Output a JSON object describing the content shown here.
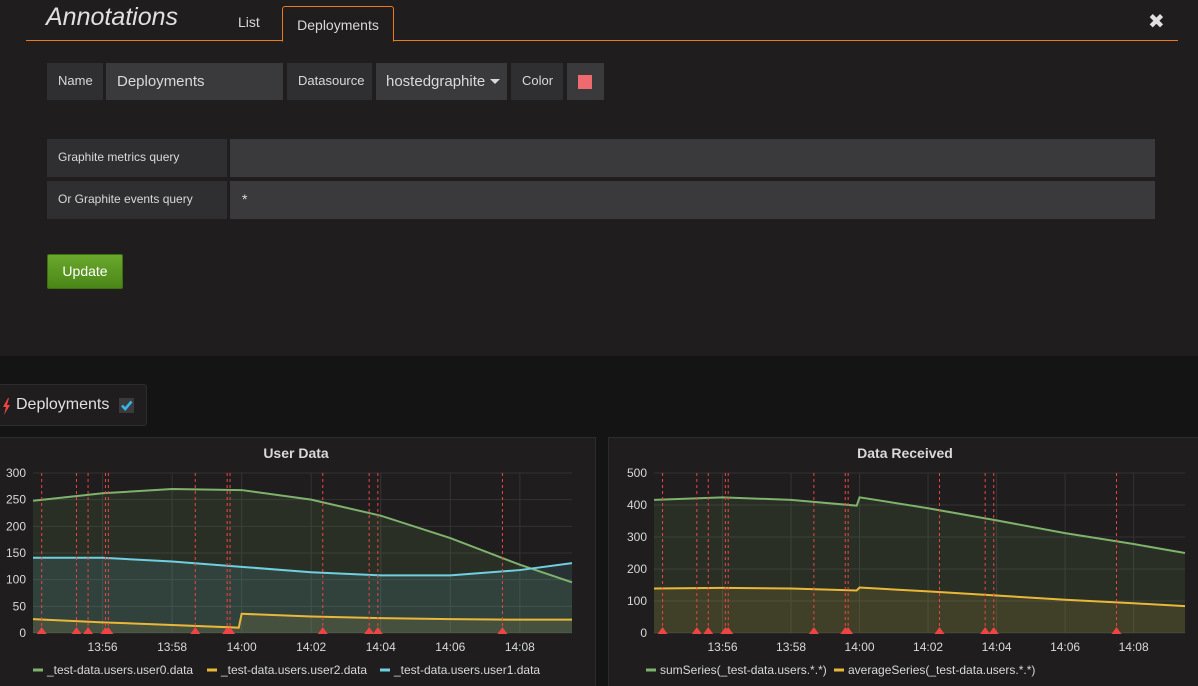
{
  "editor": {
    "title": "Annotations",
    "tabs": [
      {
        "label": "List"
      },
      {
        "label": "Deployments"
      }
    ],
    "close_glyph": "✖",
    "name_label": "Name",
    "name_value": "Deployments",
    "datasource_label": "Datasource",
    "datasource_value": "hostedgraphite",
    "color_label": "Color",
    "color_value": "#ee6a6f",
    "metrics_query_label": "Graphite metrics query",
    "metrics_query_value": "",
    "events_query_label": "Or Graphite events query",
    "events_query_value": "*",
    "update_label": "Update"
  },
  "annotation_toggle": {
    "icon": "bolt-icon",
    "name": "Deployments",
    "checked": true
  },
  "chart_data": [
    {
      "type": "line",
      "title": "User Data",
      "x_ticks": [
        "13:56",
        "13:58",
        "14:00",
        "14:02",
        "14:04",
        "14:06",
        "14:08"
      ],
      "ylim": [
        0,
        300
      ],
      "y_ticks": [
        0,
        50,
        100,
        150,
        200,
        250,
        300
      ],
      "grid": true,
      "legend_position": "bottom",
      "annotations": [
        "13:54:15",
        "13:55:15",
        "13:55:35",
        "13:56:05",
        "13:56:10",
        "13:58:40",
        "13:59:35",
        "13:59:40",
        "14:02:20",
        "14:03:40",
        "14:03:55",
        "14:07:30"
      ],
      "series": [
        {
          "name": "_test-data.users.user0.data",
          "color": "#7eb26d",
          "x": [
            "13:54",
            "13:56",
            "13:58",
            "14:00",
            "14:02",
            "14:04",
            "14:06",
            "14:08",
            "14:09:30"
          ],
          "values": [
            248,
            262,
            270,
            268,
            250,
            220,
            178,
            128,
            95
          ]
        },
        {
          "name": "_test-data.users.user2.data",
          "color": "#eab839",
          "x": [
            "13:54",
            "13:56",
            "13:58",
            "13:59:55",
            "14:00",
            "14:02",
            "14:04",
            "14:06",
            "14:08",
            "14:09:30"
          ],
          "values": [
            26,
            20,
            15,
            10,
            36,
            31,
            28,
            26,
            25,
            25
          ]
        },
        {
          "name": "_test-data.users.user1.data",
          "color": "#6ed0e0",
          "x": [
            "13:54",
            "13:56",
            "13:58",
            "14:00",
            "14:02",
            "14:04",
            "14:06",
            "14:08",
            "14:09:30"
          ],
          "values": [
            141,
            141,
            134,
            124,
            114,
            108,
            108,
            118,
            131
          ]
        }
      ]
    },
    {
      "type": "line",
      "title": "Data Received",
      "x_ticks": [
        "13:56",
        "13:58",
        "14:00",
        "14:02",
        "14:04",
        "14:06",
        "14:08"
      ],
      "ylim": [
        0,
        500
      ],
      "y_ticks": [
        0,
        100,
        200,
        300,
        400,
        500
      ],
      "grid": true,
      "legend_position": "bottom",
      "annotations": [
        "13:54:15",
        "13:55:15",
        "13:55:35",
        "13:56:05",
        "13:56:10",
        "13:58:40",
        "13:59:35",
        "13:59:40",
        "14:02:20",
        "14:03:40",
        "14:03:55",
        "14:07:30"
      ],
      "series": [
        {
          "name": "sumSeries(_test-data.users.*.*)",
          "color": "#7eb26d",
          "x": [
            "13:54",
            "13:56",
            "13:58",
            "13:59:55",
            "14:00",
            "14:02",
            "14:04",
            "14:06",
            "14:08",
            "14:09:30"
          ],
          "values": [
            416,
            424,
            416,
            398,
            424,
            390,
            352,
            312,
            278,
            250
          ]
        },
        {
          "name": "averageSeries(_test-data.users.*.*)",
          "color": "#eab839",
          "x": [
            "13:54",
            "13:56",
            "13:58",
            "13:59:55",
            "14:00",
            "14:02",
            "14:04",
            "14:06",
            "14:08",
            "14:09:30"
          ],
          "values": [
            139,
            141,
            139,
            133,
            142,
            130,
            117,
            104,
            93,
            84
          ]
        }
      ]
    }
  ]
}
